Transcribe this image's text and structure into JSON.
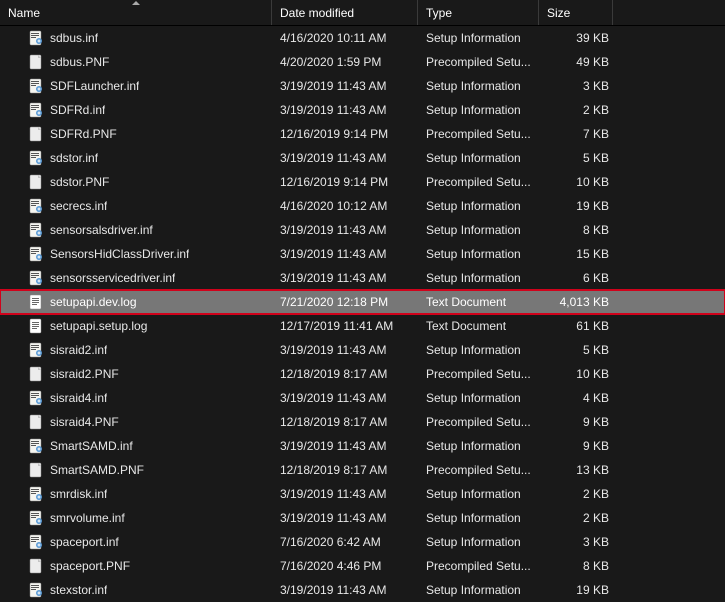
{
  "columns": {
    "name": "Name",
    "date": "Date modified",
    "type": "Type",
    "size": "Size"
  },
  "files": [
    {
      "name": "sdbus.inf",
      "date": "4/16/2020 10:11 AM",
      "type": "Setup Information",
      "size": "39 KB",
      "icon": "inf"
    },
    {
      "name": "sdbus.PNF",
      "date": "4/20/2020 1:59 PM",
      "type": "Precompiled Setu...",
      "size": "49 KB",
      "icon": "pnf"
    },
    {
      "name": "SDFLauncher.inf",
      "date": "3/19/2019 11:43 AM",
      "type": "Setup Information",
      "size": "3 KB",
      "icon": "inf"
    },
    {
      "name": "SDFRd.inf",
      "date": "3/19/2019 11:43 AM",
      "type": "Setup Information",
      "size": "2 KB",
      "icon": "inf"
    },
    {
      "name": "SDFRd.PNF",
      "date": "12/16/2019 9:14 PM",
      "type": "Precompiled Setu...",
      "size": "7 KB",
      "icon": "pnf"
    },
    {
      "name": "sdstor.inf",
      "date": "3/19/2019 11:43 AM",
      "type": "Setup Information",
      "size": "5 KB",
      "icon": "inf"
    },
    {
      "name": "sdstor.PNF",
      "date": "12/16/2019 9:14 PM",
      "type": "Precompiled Setu...",
      "size": "10 KB",
      "icon": "pnf"
    },
    {
      "name": "secrecs.inf",
      "date": "4/16/2020 10:12 AM",
      "type": "Setup Information",
      "size": "19 KB",
      "icon": "inf"
    },
    {
      "name": "sensorsalsdriver.inf",
      "date": "3/19/2019 11:43 AM",
      "type": "Setup Information",
      "size": "8 KB",
      "icon": "inf"
    },
    {
      "name": "SensorsHidClassDriver.inf",
      "date": "3/19/2019 11:43 AM",
      "type": "Setup Information",
      "size": "15 KB",
      "icon": "inf"
    },
    {
      "name": "sensorsservicedriver.inf",
      "date": "3/19/2019 11:43 AM",
      "type": "Setup Information",
      "size": "6 KB",
      "icon": "inf"
    },
    {
      "name": "setupapi.dev.log",
      "date": "7/21/2020 12:18 PM",
      "type": "Text Document",
      "size": "4,013 KB",
      "icon": "txt",
      "selected": true,
      "highlighted": true
    },
    {
      "name": "setupapi.setup.log",
      "date": "12/17/2019 11:41 AM",
      "type": "Text Document",
      "size": "61 KB",
      "icon": "txt"
    },
    {
      "name": "sisraid2.inf",
      "date": "3/19/2019 11:43 AM",
      "type": "Setup Information",
      "size": "5 KB",
      "icon": "inf"
    },
    {
      "name": "sisraid2.PNF",
      "date": "12/18/2019 8:17 AM",
      "type": "Precompiled Setu...",
      "size": "10 KB",
      "icon": "pnf"
    },
    {
      "name": "sisraid4.inf",
      "date": "3/19/2019 11:43 AM",
      "type": "Setup Information",
      "size": "4 KB",
      "icon": "inf"
    },
    {
      "name": "sisraid4.PNF",
      "date": "12/18/2019 8:17 AM",
      "type": "Precompiled Setu...",
      "size": "9 KB",
      "icon": "pnf"
    },
    {
      "name": "SmartSAMD.inf",
      "date": "3/19/2019 11:43 AM",
      "type": "Setup Information",
      "size": "9 KB",
      "icon": "inf"
    },
    {
      "name": "SmartSAMD.PNF",
      "date": "12/18/2019 8:17 AM",
      "type": "Precompiled Setu...",
      "size": "13 KB",
      "icon": "pnf"
    },
    {
      "name": "smrdisk.inf",
      "date": "3/19/2019 11:43 AM",
      "type": "Setup Information",
      "size": "2 KB",
      "icon": "inf"
    },
    {
      "name": "smrvolume.inf",
      "date": "3/19/2019 11:43 AM",
      "type": "Setup Information",
      "size": "2 KB",
      "icon": "inf"
    },
    {
      "name": "spaceport.inf",
      "date": "7/16/2020 6:42 AM",
      "type": "Setup Information",
      "size": "3 KB",
      "icon": "inf"
    },
    {
      "name": "spaceport.PNF",
      "date": "7/16/2020 4:46 PM",
      "type": "Precompiled Setu...",
      "size": "8 KB",
      "icon": "pnf"
    },
    {
      "name": "stexstor.inf",
      "date": "3/19/2019 11:43 AM",
      "type": "Setup Information",
      "size": "19 KB",
      "icon": "inf"
    }
  ]
}
